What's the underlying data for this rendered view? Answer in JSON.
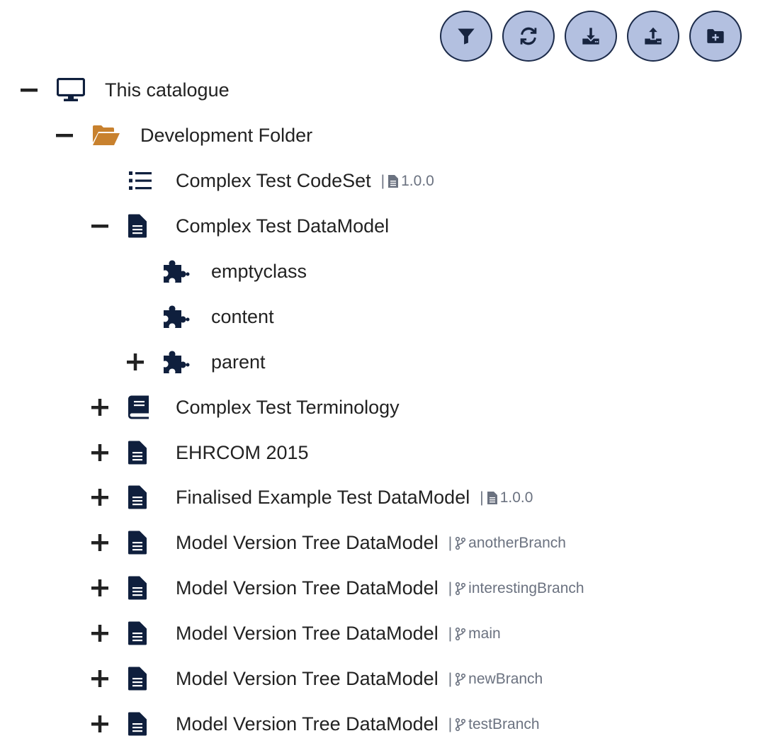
{
  "toolbar": {
    "buttons": [
      {
        "name": "filter",
        "icon": "filter-icon"
      },
      {
        "name": "refresh",
        "icon": "refresh-icon"
      },
      {
        "name": "download",
        "icon": "download-icon"
      },
      {
        "name": "upload",
        "icon": "upload-icon"
      },
      {
        "name": "add-folder",
        "icon": "folder-plus-icon"
      }
    ],
    "button_color": "#b3c0e0",
    "icon_color": "#17243f"
  },
  "tree": {
    "catalogue": {
      "label": "This catalogue",
      "icon": "desktop-icon",
      "expanded": true
    },
    "folder": {
      "label": "Development Folder",
      "icon": "folder-open-icon",
      "expanded": true,
      "color": "#c8812e"
    },
    "codeset": {
      "label": "Complex Test CodeSet",
      "icon": "list-icon",
      "version": "1.0.0"
    },
    "datamodel": {
      "label": "Complex Test DataModel",
      "icon": "document-icon",
      "expanded": true
    },
    "class_emptyclass": {
      "label": "emptyclass",
      "icon": "puzzle-icon"
    },
    "class_content": {
      "label": "content",
      "icon": "puzzle-icon"
    },
    "class_parent": {
      "label": "parent",
      "icon": "puzzle-icon",
      "expanded": false
    },
    "terminology": {
      "label": "Complex Test Terminology",
      "icon": "book-icon",
      "expanded": false
    },
    "ehrcom": {
      "label": "EHRCOM 2015",
      "icon": "document-icon",
      "expanded": false
    },
    "finalised": {
      "label": "Finalised Example Test DataModel",
      "icon": "document-icon",
      "expanded": false,
      "version": "1.0.0"
    },
    "mvt_another": {
      "label": "Model Version Tree DataModel",
      "icon": "document-icon",
      "expanded": false,
      "branch": "anotherBranch"
    },
    "mvt_interesting": {
      "label": "Model Version Tree DataModel",
      "icon": "document-icon",
      "expanded": false,
      "branch": "interestingBranch"
    },
    "mvt_main": {
      "label": "Model Version Tree DataModel",
      "icon": "document-icon",
      "expanded": false,
      "branch": "main"
    },
    "mvt_new": {
      "label": "Model Version Tree DataModel",
      "icon": "document-icon",
      "expanded": false,
      "branch": "newBranch"
    },
    "mvt_test": {
      "label": "Model Version Tree DataModel",
      "icon": "document-icon",
      "expanded": false,
      "branch": "testBranch"
    }
  },
  "separator": "|",
  "icon_color": "#0f1f3d",
  "meta_color": "#6b7280"
}
